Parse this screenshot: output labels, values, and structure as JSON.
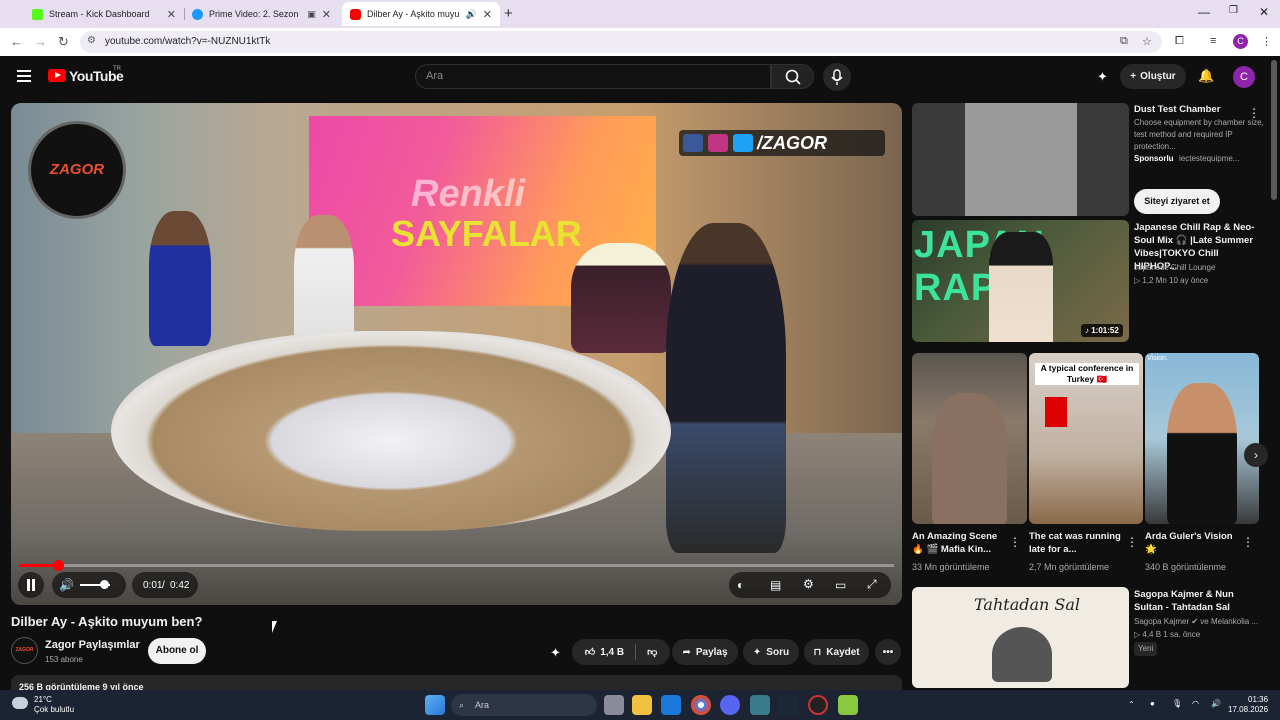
{
  "browser": {
    "tabs": [
      {
        "title": "Stream - Kick Dashboard",
        "color": "#53fc18"
      },
      {
        "title": "Prime Video: 2. Sezon",
        "color": "#1a98ff"
      },
      {
        "title": "Dilber Ay - Aşkito muyum b",
        "color": "#ff0000"
      }
    ],
    "new_tab": "+",
    "url": "youtube.com/watch?v=-NUZNU1ktTk",
    "profile_initial": "C"
  },
  "header": {
    "logo_text": "YouTube",
    "region": "TR",
    "search_placeholder": "Ara",
    "create_label": "Oluştur",
    "avatar_initial": "C"
  },
  "player": {
    "watermark": "ZAGOR",
    "social_handle": "/ZAGOR",
    "screen_text_1": "Renkli",
    "screen_text_2": "SAYFALAR",
    "time_current": "0:01",
    "time_total": "0:42",
    "time_separator": "/",
    "progress": 0.045,
    "volume": 0.8
  },
  "video": {
    "title": "Dilber Ay - Aşkito muyum ben?",
    "channel": "Zagor Paylaşımlar",
    "channel_avatar_text": "ZAGOR",
    "subscribers": "153 abone",
    "subscribe_label": "Abone ol",
    "likes": "1,4 B",
    "share_label": "Paylaş",
    "ask_label": "Soru",
    "save_label": "Kaydet",
    "description_line": "256 B görüntüleme  9 yıl önce"
  },
  "sidebar": {
    "ad": {
      "title": "Dust Test Chamber",
      "desc": "Choose equipment by chamber size, test method and required IP protection...",
      "sponsor_label": "Sponsorlu",
      "sponsor_domain": "iectestequipme...",
      "cta": "Siteyi ziyaret et"
    },
    "mix": {
      "title": "Japanese Chill Rap & Neo-Soul Mix 🎧 |Late Summer Vibes|TOKYO Chill HIPHOP...",
      "channel": "Japanese Chill Lounge",
      "meta": "1,2 Mn   10 ay önce",
      "duration": "1:01:52",
      "thumb_text": "JAPAN RAP"
    },
    "shorts": [
      {
        "title": "An Amazing Scene 🔥 🎬 Mafia Kin...",
        "views": "33 Mn görüntüleme"
      },
      {
        "title": "The cat was running late for a...",
        "views": "2,7 Mn görüntüleme",
        "overlay": "A typical conference in Turkey 🇹🇷"
      },
      {
        "title": "Arda Guler's Vision 🌟",
        "views": "340 B görüntülenme",
        "corner": "Vision."
      }
    ],
    "next": {
      "title": "Sagopa Kajmer & Nun Sultan - Tahtadan Sal",
      "channel": "Sagopa Kajmer ✔ ve Melankolia ...",
      "meta": "4,4 B   1 sa. önce",
      "badge": "Yeni",
      "thumb_text": "Tahtadan Sal"
    }
  },
  "taskbar": {
    "weather_temp": "21°C",
    "weather_desc": "Çok bulutlu",
    "search_label": "Ara",
    "time": "01:36",
    "date": "17.08.2026"
  }
}
